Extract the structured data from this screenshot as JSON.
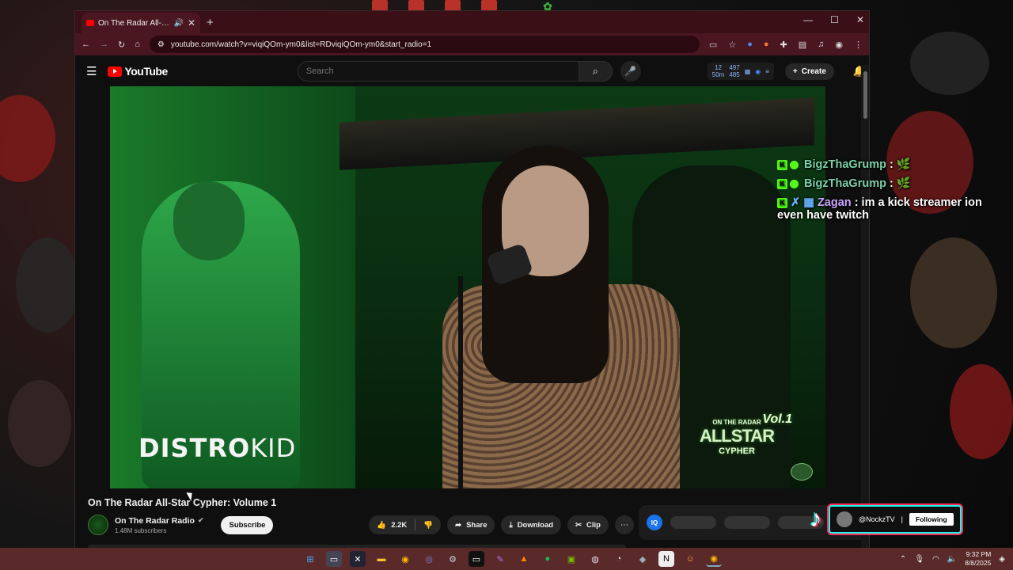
{
  "browser": {
    "tab_title": "On The Radar All-Star Cyph",
    "url": "youtube.com/watch?v=viqiQOm-ym0&list=RDviqiQOm-ym0&start_radio=1"
  },
  "desktop": {
    "center_label": "12"
  },
  "youtube": {
    "logo_text": "YouTube",
    "search_placeholder": "Search",
    "stats": {
      "a": "12",
      "a_sub": "50m",
      "b": "497",
      "b_sub": "485"
    },
    "create_label": "Create"
  },
  "video": {
    "watermark_bold": "DISTRO",
    "watermark_light": "KID",
    "badge": {
      "line1": "ON THE RADAR",
      "line2": "ALLSTAR",
      "line3": "CYPHER",
      "vol": "Vol.1"
    },
    "title": "On The Radar All-Star Cypher: Volume 1",
    "channel": "On The Radar Radio",
    "subscribers": "1.48M subscribers",
    "subscribe_label": "Subscribe",
    "likes": "2.2K",
    "share_label": "Share",
    "download_label": "Download",
    "clip_label": "Clip"
  },
  "sidebar": {
    "iq_label": "IQ"
  },
  "chat": [
    {
      "user": "BigzThaGrump",
      "message": ": 🌿"
    },
    {
      "user": "BigzThaGrump",
      "message": ": 🌿"
    },
    {
      "user": "Zagan",
      "message": ": im a kick streamer ion even have twitch"
    }
  ],
  "tiktok": {
    "handle": "@NockzTV",
    "separator": "|",
    "button": "Following"
  },
  "taskbar": {
    "time": "9:32 PM",
    "date": "8/8/2025"
  },
  "colors": {
    "kick_green": "#53fc18",
    "youtube_red": "#ff0000",
    "tiktok_cyan": "#25f4ee",
    "tiktok_pink": "#fe2c55"
  }
}
